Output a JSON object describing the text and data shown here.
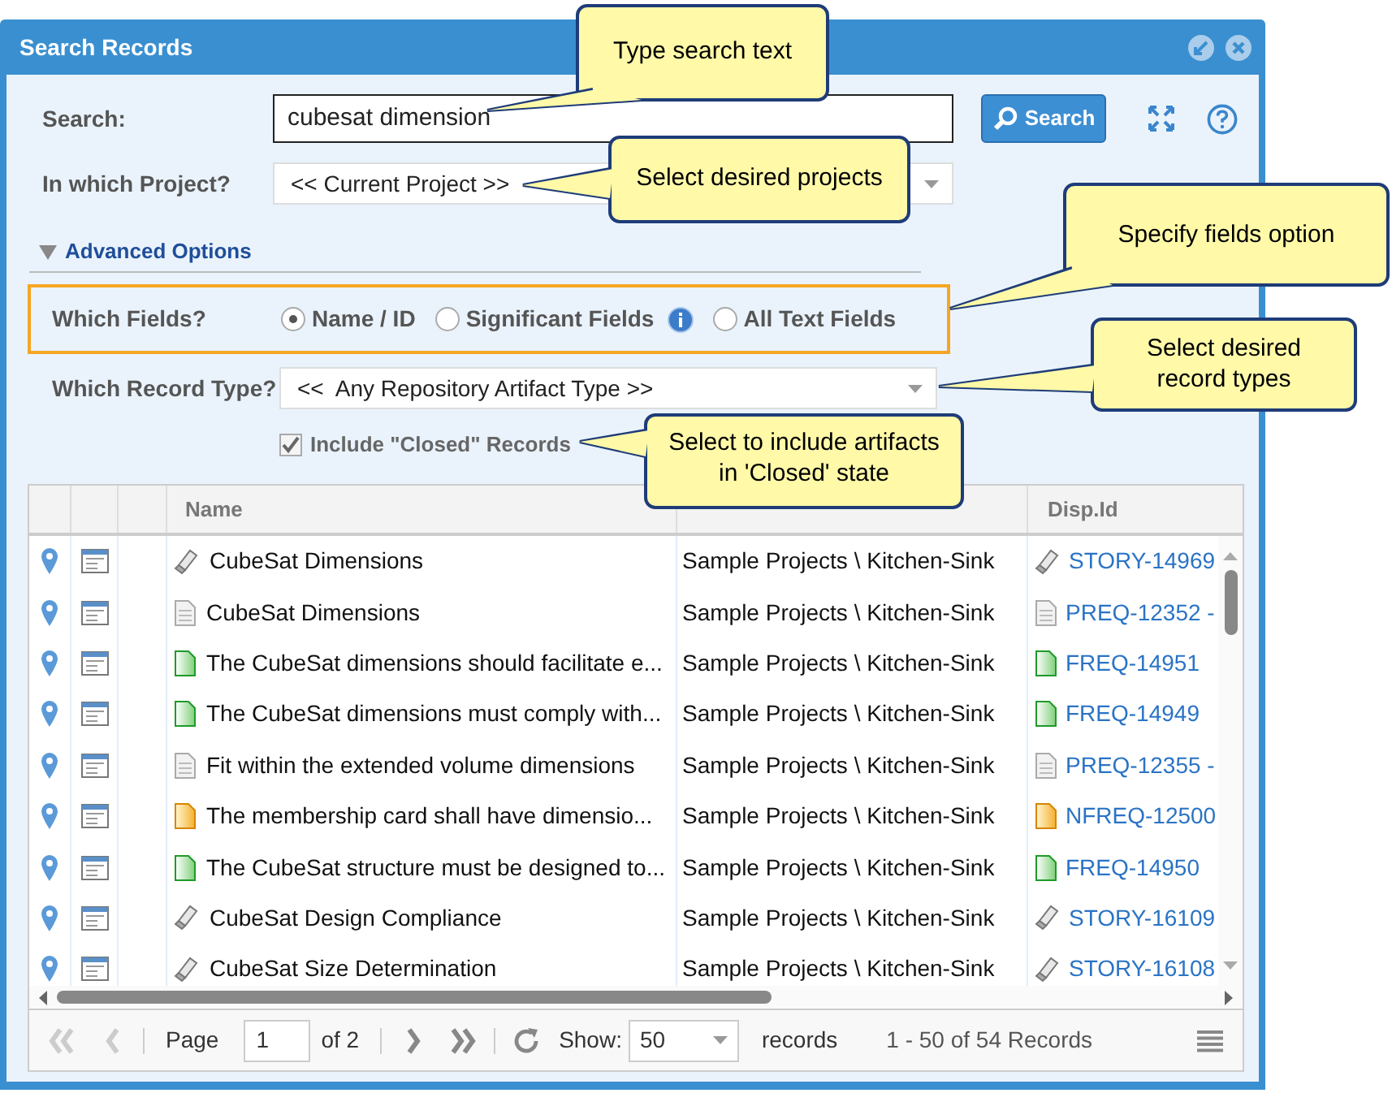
{
  "window": {
    "title": "Search Records"
  },
  "search": {
    "label": "Search:",
    "value": "cubesat dimension",
    "button": "Search"
  },
  "project": {
    "label": "In which Project?",
    "value": "<< Current Project >>"
  },
  "advanced_options": {
    "label": "Advanced Options",
    "expanded": true
  },
  "which_fields": {
    "label": "Which Fields?",
    "options": [
      {
        "label": "Name / ID",
        "selected": true,
        "info": false
      },
      {
        "label": "Significant Fields",
        "selected": false,
        "info": true
      },
      {
        "label": "All Text Fields",
        "selected": false,
        "info": false
      }
    ]
  },
  "record_type": {
    "label": "Which Record Type?",
    "value": "<<  Any Repository Artifact Type >>"
  },
  "include_closed": {
    "label": "Include \"Closed\" Records",
    "checked": true
  },
  "table": {
    "name_header": "Name",
    "id_header": "Disp.Id",
    "rows": [
      {
        "kind": "story",
        "name": "CubeSat Dimensions",
        "project": "Sample Projects \\ Kitchen-Sink",
        "id": "STORY-14969"
      },
      {
        "kind": "doc",
        "name": "CubeSat Dimensions",
        "project": "Sample Projects \\ Kitchen-Sink",
        "id": "PREQ-12352 -"
      },
      {
        "kind": "green",
        "name": "The CubeSat dimensions should facilitate e...",
        "project": "Sample Projects \\ Kitchen-Sink",
        "id": "FREQ-14951"
      },
      {
        "kind": "green",
        "name": "The CubeSat dimensions must comply with...",
        "project": "Sample Projects \\ Kitchen-Sink",
        "id": "FREQ-14949"
      },
      {
        "kind": "doc",
        "name": "Fit within the extended volume dimensions",
        "project": "Sample Projects \\ Kitchen-Sink",
        "id": "PREQ-12355 -"
      },
      {
        "kind": "orange",
        "name": "The membership card shall have dimensio...",
        "project": "Sample Projects \\ Kitchen-Sink",
        "id": "NFREQ-12500"
      },
      {
        "kind": "green",
        "name": "The CubeSat structure must be designed to...",
        "project": "Sample Projects \\ Kitchen-Sink",
        "id": "FREQ-14950"
      },
      {
        "kind": "story",
        "name": "CubeSat Design Compliance",
        "project": "Sample Projects \\ Kitchen-Sink",
        "id": "STORY-16109"
      },
      {
        "kind": "story",
        "name": "CubeSat Size Determination",
        "project": "Sample Projects \\ Kitchen-Sink",
        "id": "STORY-16108"
      }
    ]
  },
  "pager": {
    "page_label": "Page",
    "page": "1",
    "of": "of 2",
    "show_label": "Show:",
    "page_size": "50",
    "records_label": "records",
    "summary": "1 - 50 of 54 Records"
  },
  "callouts": [
    {
      "text": "Type search text"
    },
    {
      "text": "Select desired projects"
    },
    {
      "text": "Specify fields option"
    },
    {
      "text": "Select desired record types"
    },
    {
      "text": "Select to include artifacts in 'Closed' state"
    }
  ]
}
